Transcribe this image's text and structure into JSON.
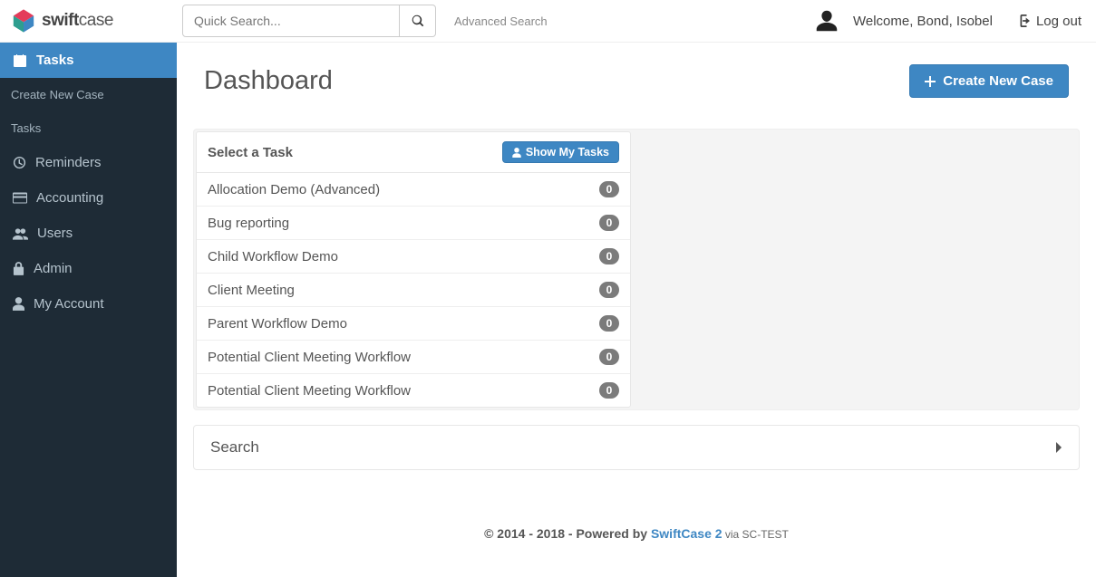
{
  "brand": {
    "name_bold": "swift",
    "name_light": "case"
  },
  "search": {
    "placeholder": "Quick Search...",
    "advanced_label": "Advanced Search"
  },
  "user": {
    "welcome_text": "Welcome, Bond, Isobel",
    "logout_label": "Log out"
  },
  "sidebar": {
    "active": {
      "label": "Tasks"
    },
    "sub_items": [
      {
        "label": "Create New Case"
      },
      {
        "label": "Tasks"
      }
    ],
    "items": [
      {
        "label": "Reminders",
        "icon": "clock"
      },
      {
        "label": "Accounting",
        "icon": "card"
      },
      {
        "label": "Users",
        "icon": "users"
      },
      {
        "label": "Admin",
        "icon": "lock"
      },
      {
        "label": "My Account",
        "icon": "user"
      }
    ]
  },
  "page": {
    "title": "Dashboard",
    "create_button_label": "Create New Case"
  },
  "task_panel": {
    "header": "Select a Task",
    "show_my_tasks_label": "Show My Tasks",
    "tasks": [
      {
        "name": "Allocation Demo (Advanced)",
        "count": "0"
      },
      {
        "name": "Bug reporting",
        "count": "0"
      },
      {
        "name": "Child Workflow Demo",
        "count": "0"
      },
      {
        "name": "Client Meeting",
        "count": "0"
      },
      {
        "name": "Parent Workflow Demo",
        "count": "0"
      },
      {
        "name": "Potential Client Meeting Workflow",
        "count": "0"
      },
      {
        "name": "Potential Client Meeting Workflow",
        "count": "0"
      }
    ]
  },
  "search_panel": {
    "title": "Search"
  },
  "footer": {
    "copyright": "© 2014 - 2018 - Powered by ",
    "link": "SwiftCase 2",
    "via": " via SC-TEST"
  }
}
